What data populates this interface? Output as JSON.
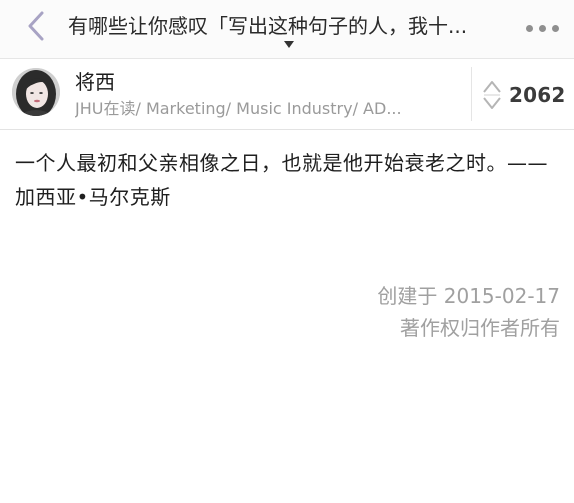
{
  "header": {
    "back_icon": "chevron-left-icon",
    "title": "有哪些让你感叹「写出这种句子的人，我十...",
    "more_icon": "more-dots-icon",
    "caret_icon": "caret-down-icon"
  },
  "answer": {
    "author_name": "将西",
    "author_bio": "JHU在读/ Marketing/ Music Industry/ AD...",
    "vote_icon": "upvote-downvote-icon",
    "vote_count": "2062",
    "content": "一个人最初和父亲相像之日，也就是他开始衰老之时。——加西亚•马尔克斯",
    "created": "创建于 2015-02-17",
    "copyright": "著作权归作者所有"
  },
  "colors": {
    "header_bg": "#fbfbfb",
    "divider": "#e3e3e3",
    "meta_text": "#a0a0a0",
    "bio_text": "#9a9a9a",
    "icon_gray": "#8f8f8f",
    "back_icon_color": "#a8a3c4"
  }
}
